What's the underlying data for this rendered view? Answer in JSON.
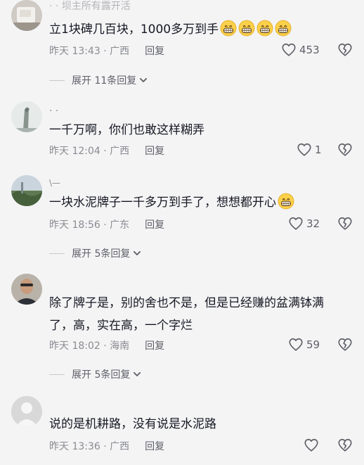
{
  "comments": [
    {
      "username": "· · 坝主所有露开活",
      "text": "立1块碑几百块，1000多万到手",
      "time": "昨天 13:43",
      "location": "广西",
      "reply": "回复",
      "likes": "453",
      "expand": "展开 11条回复"
    },
    {
      "username": "· ·",
      "text": "一千万啊，你们也敢这样糊弄",
      "time": "昨天 12:04",
      "location": "广西",
      "reply": "回复",
      "likes": "1"
    },
    {
      "username": "\\—",
      "text": "一块水泥牌子一千多万到手了，想想都开心",
      "time": "昨天 18:56",
      "location": "广东",
      "reply": "回复",
      "likes": "32",
      "expand": "展开 5条回复"
    },
    {
      "username": "",
      "text_line1": "除了牌子是，别的舍也不是，但是已经赚的盆满钵满",
      "text_line2": "了，高，实在高，一个字烂",
      "time": "昨天 18:02",
      "location": "海南",
      "reply": "回复",
      "likes": "59",
      "expand": "展开 5条回复"
    },
    {
      "username": "",
      "text": "说的是机耕路，没有说是水泥路",
      "time": "昨天 13:36",
      "location": "广西",
      "reply": "回复",
      "likes": ""
    }
  ],
  "icons": {
    "like": "heart-outline-icon",
    "dislike": "broken-heart-icon",
    "expand": "chevron-down-icon",
    "emoji": "grinning-face-emoji"
  },
  "colors": {
    "background": "#f4f4f5",
    "text": "#161823",
    "meta": "#8a8b91"
  }
}
